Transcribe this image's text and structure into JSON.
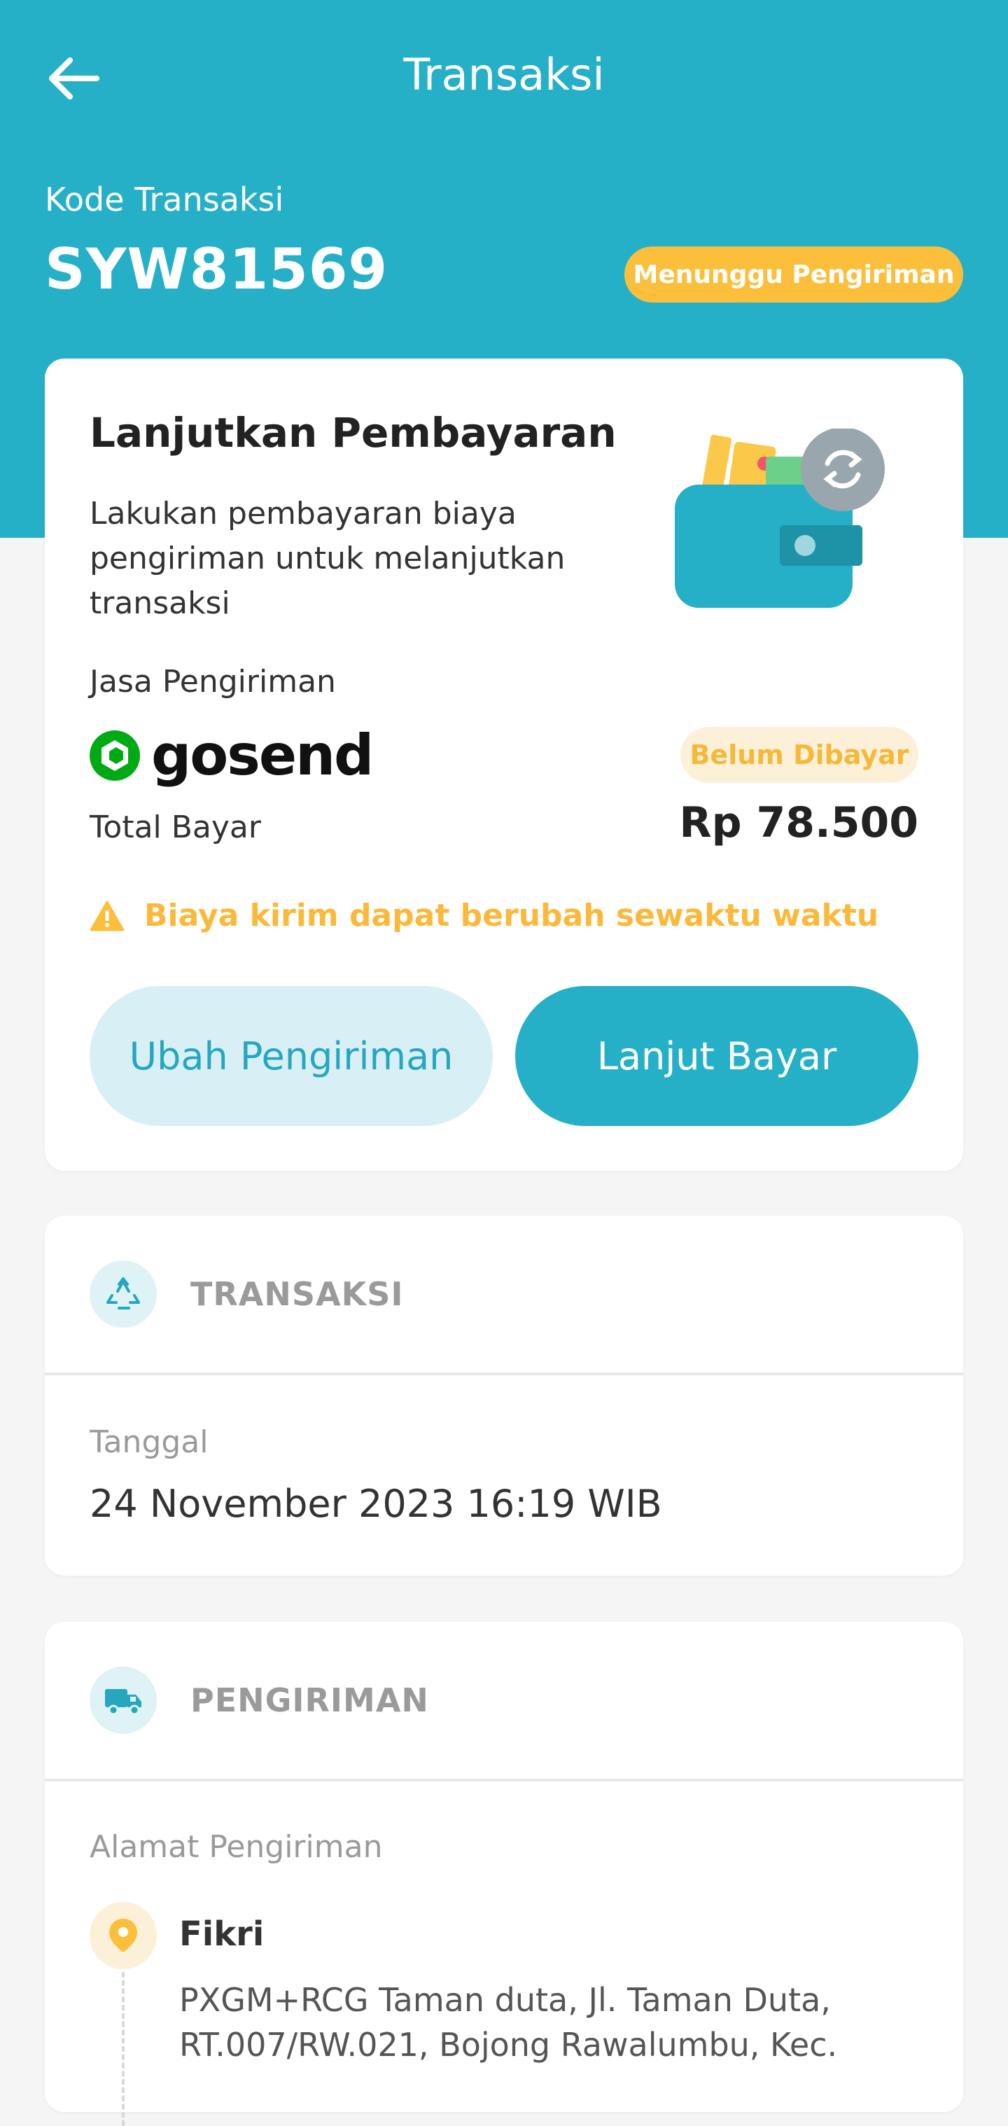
{
  "header": {
    "title": "Transaksi",
    "code_label": "Kode Transaksi",
    "code_value": "SYW81569",
    "status": "Menunggu Pengiriman"
  },
  "payment_card": {
    "title": "Lanjutkan Pembayaran",
    "description": "Lakukan pembayaran biaya pengiriman untuk melanjutkan transaksi",
    "service_label": "Jasa Pengiriman",
    "service_name": "gosend",
    "payment_status": "Belum Dibayar",
    "total_label": "Total Bayar",
    "total_value": "Rp 78.500",
    "warning": "Biaya kirim dapat berubah sewaktu waktu",
    "change_button": "Ubah Pengiriman",
    "pay_button": "Lanjut Bayar"
  },
  "transaction_section": {
    "title": "TRANSAKSI",
    "date_label": "Tanggal",
    "date_value": "24 November 2023 16:19 WIB"
  },
  "shipping_section": {
    "title": "PENGIRIMAN",
    "address_label": "Alamat Pengiriman",
    "recipient": "Fikri",
    "address": "PXGM+RCG Taman duta, Jl. Taman Duta, RT.007/RW.021, Bojong Rawalumbu, Kec."
  },
  "colors": {
    "primary": "#26b0c8",
    "warning": "#fbbf3c",
    "background": "#f5f5f5"
  },
  "icons": {
    "back": "arrow-left-icon",
    "refresh": "refresh-icon",
    "warning": "warning-triangle-icon",
    "transaction": "recycle-icon",
    "shipping": "truck-icon",
    "location": "location-pin-icon"
  }
}
